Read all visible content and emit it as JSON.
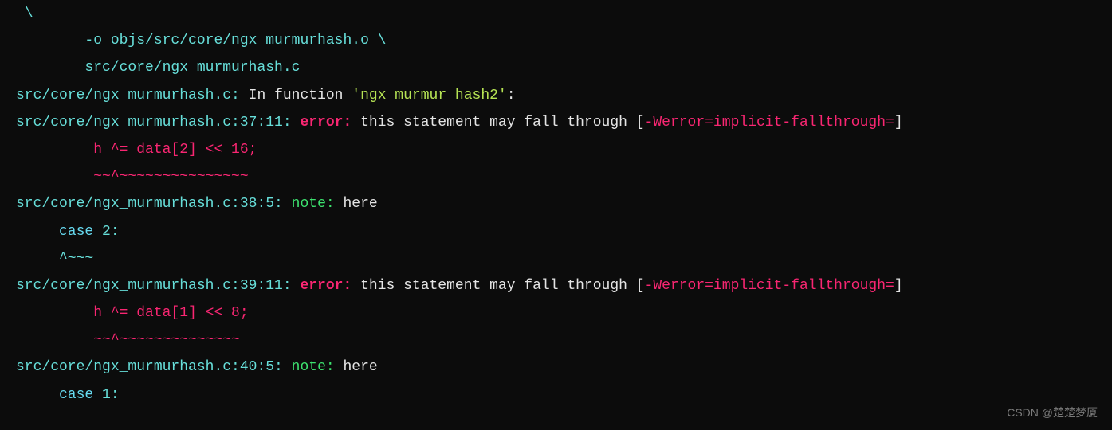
{
  "lines": {
    "l0": " \\",
    "l1_a": "        -o objs/src/core/ngx_murmurhash.o \\",
    "l2_a": "        src/core/ngx_murmurhash.c",
    "l3_a": "src/core/ngx_murmurhash.c:",
    "l3_b": " In function ",
    "l3_c": "'ngx_murmur_hash2'",
    "l3_d": ":",
    "l4_a": "src/core/ngx_murmurhash.c:37:11:",
    "l4_b": " error: ",
    "l4_c": "this statement may fall through [",
    "l4_d": "-Werror=implicit-fallthrough=",
    "l4_e": "]",
    "l5_a": "         h ^= data[2] << 16;",
    "l6_a": "         ~~^~~~~~~~~~~~~~~~",
    "l7_a": "src/core/ngx_murmurhash.c:38:5:",
    "l7_b": " note: ",
    "l7_c": "here",
    "l8_a": "     case",
    "l8_b": " 2:",
    "l9_a": "     ^~~~",
    "l10_a": "src/core/ngx_murmurhash.c:39:11:",
    "l10_b": " error: ",
    "l10_c": "this statement may fall through [",
    "l10_d": "-Werror=implicit-fallthrough=",
    "l10_e": "]",
    "l11_a": "         h ^= data[1] << 8;",
    "l12_a": "         ~~^~~~~~~~~~~~~~~",
    "l13_a": "src/core/ngx_murmurhash.c:40:5:",
    "l13_b": " note: ",
    "l13_c": "here",
    "l14_a": "     case",
    "l14_b": " 1:"
  },
  "watermark": "CSDN @楚楚梦厦"
}
